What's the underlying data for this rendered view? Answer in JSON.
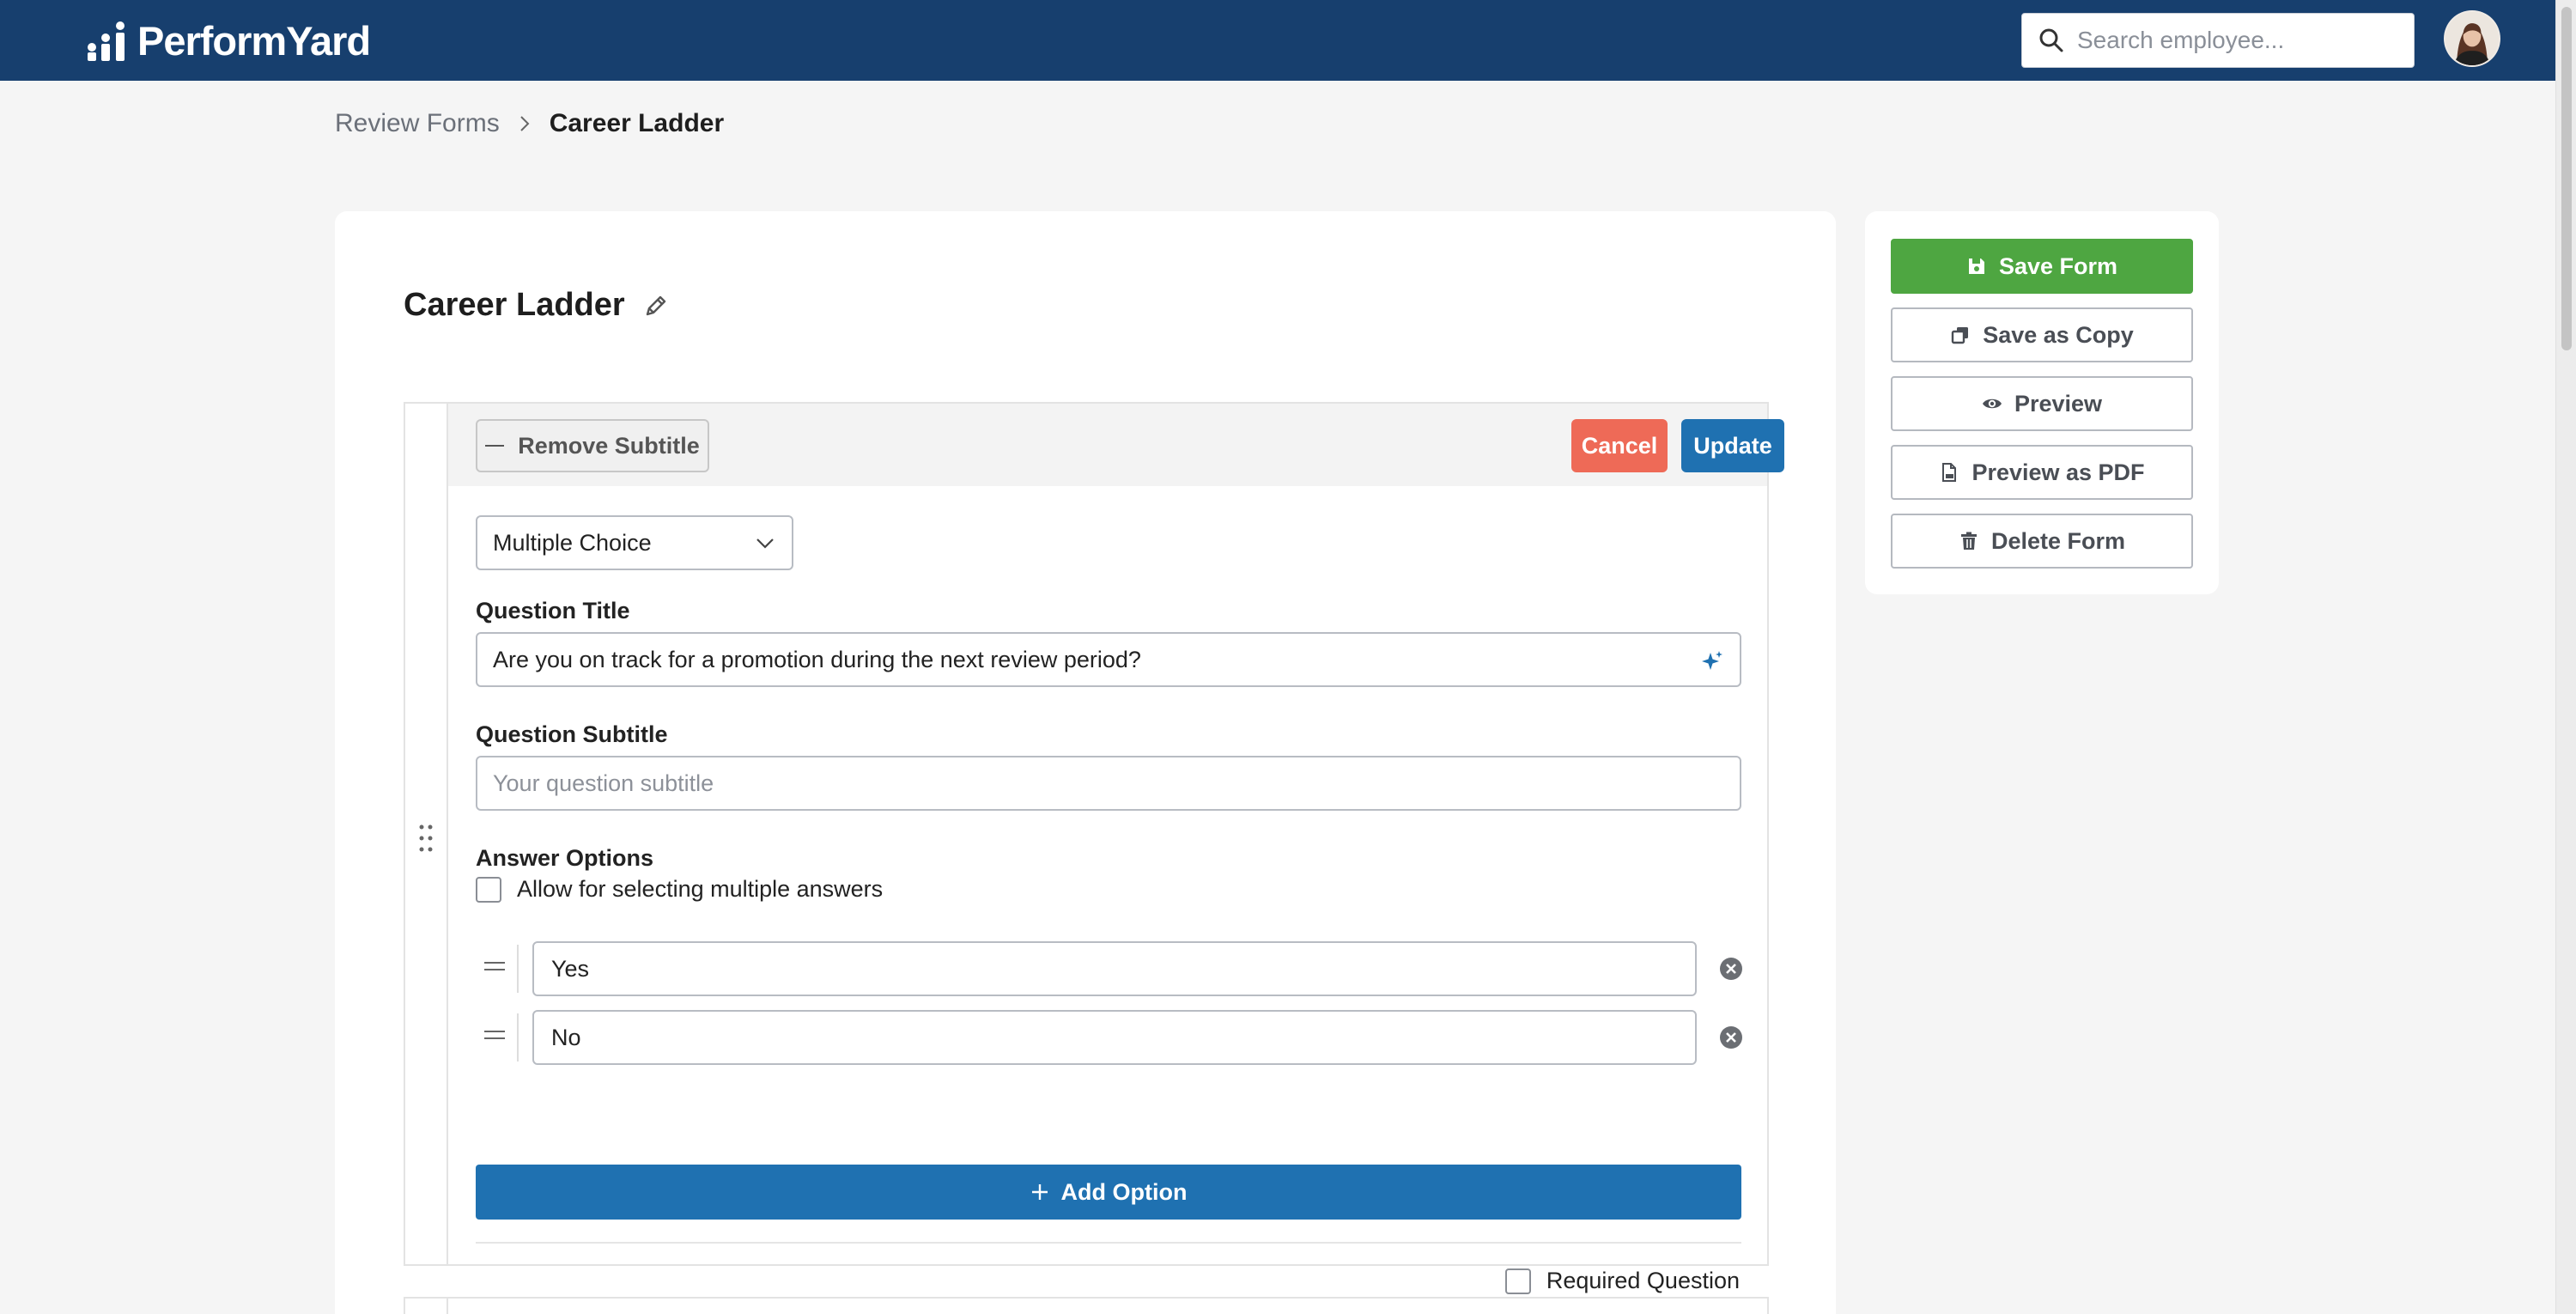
{
  "app": {
    "logo_text": "PerformYard",
    "search_placeholder": "Search employee..."
  },
  "breadcrumb": {
    "parent": "Review Forms",
    "current": "Career Ladder"
  },
  "form": {
    "title": "Career Ladder"
  },
  "question_editor": {
    "remove_subtitle_label": "Remove Subtitle",
    "cancel_label": "Cancel",
    "update_label": "Update",
    "question_type": "Multiple Choice",
    "title_label": "Question Title",
    "title_value": "Are you on track for a promotion during the next review period?",
    "subtitle_label": "Question Subtitle",
    "subtitle_placeholder": "Your question subtitle",
    "answer_options_label": "Answer Options",
    "allow_multiple_label": "Allow for selecting multiple answers",
    "options": [
      "Yes",
      "No"
    ],
    "add_option_label": "Add Option",
    "required_label": "Required Question"
  },
  "actions": {
    "save_form": "Save Form",
    "save_as_copy": "Save as Copy",
    "preview": "Preview",
    "preview_pdf": "Preview as PDF",
    "delete_form": "Delete Form"
  },
  "colors": {
    "header_bg": "#173f6e",
    "primary_blue": "#1f71b1",
    "save_green": "#4ea641",
    "cancel_red": "#ee6a57"
  }
}
